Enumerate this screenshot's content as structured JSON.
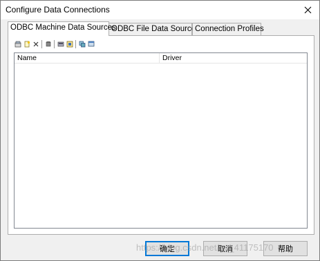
{
  "window": {
    "title": "Configure Data Connections",
    "close_icon": "close-icon"
  },
  "tabs": [
    {
      "label": "ODBC Machine Data Sources",
      "active": true
    },
    {
      "label": "ODBC File Data Sources",
      "active": false
    },
    {
      "label": "Connection Profiles",
      "active": false
    }
  ],
  "toolbar": {
    "buttons": [
      {
        "icon": "configure-icon"
      },
      {
        "icon": "new-data-source-icon"
      },
      {
        "icon": "delete-icon"
      },
      {
        "icon": "database-icon"
      },
      {
        "icon": "properties-icon"
      },
      {
        "icon": "export-icon"
      },
      {
        "icon": "copy-icon"
      },
      {
        "icon": "window-icon"
      }
    ]
  },
  "list": {
    "columns": [
      "Name",
      "Driver"
    ],
    "rows": []
  },
  "buttons": {
    "ok": "确定",
    "cancel": "取消",
    "help": "帮助"
  },
  "watermark": "https://blog.csdn.net/qq_41175170"
}
